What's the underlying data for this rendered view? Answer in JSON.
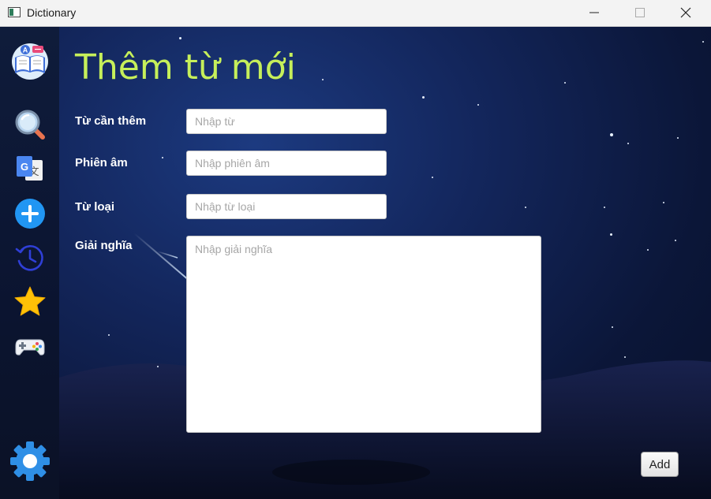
{
  "window": {
    "title": "Dictionary",
    "icon": "app-window-icon",
    "controls": [
      "minimize-icon",
      "maximize-icon",
      "close-icon"
    ]
  },
  "sidebar": {
    "items": [
      {
        "name": "dictionary-logo",
        "icon": "book-icon"
      },
      {
        "name": "search",
        "icon": "magnifier-icon"
      },
      {
        "name": "translate",
        "icon": "google-translate-icon"
      },
      {
        "name": "add-word",
        "icon": "plus-circle-icon"
      },
      {
        "name": "history",
        "icon": "history-icon"
      },
      {
        "name": "favorites",
        "icon": "star-icon"
      },
      {
        "name": "game",
        "icon": "gamepad-icon"
      },
      {
        "name": "settings",
        "icon": "gear-icon"
      }
    ]
  },
  "form": {
    "title": "Thêm từ mới",
    "word_label": "Từ cần thêm",
    "word_placeholder": "Nhập từ",
    "pronunciation_label": "Phiên âm",
    "pronunciation_placeholder": "Nhập phiên âm",
    "word_type_label": "Từ loại",
    "word_type_placeholder": "Nhập từ loại",
    "meaning_label": "Giải nghĩa",
    "meaning_placeholder": "Nhập giải nghĩa",
    "add_button": "Add"
  },
  "colors": {
    "title_color": "#c6ef5a",
    "sidebar_bg": "#0f1c3b",
    "background": "#13265c",
    "accent_blue": "#2196f3",
    "star_yellow": "#ffc107"
  }
}
